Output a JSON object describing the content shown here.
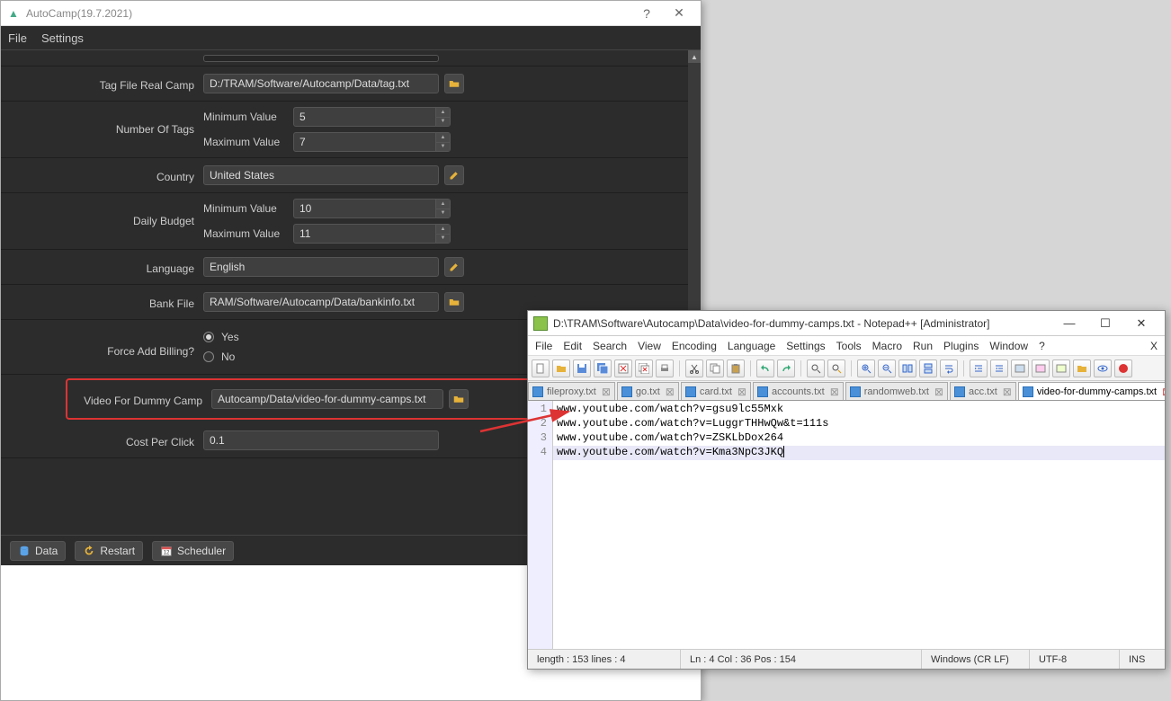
{
  "autocamp": {
    "title": "AutoCamp(19.7.2021)",
    "menus": {
      "file": "File",
      "settings": "Settings"
    },
    "rows": {
      "tagfile": {
        "label": "Tag File Real Camp",
        "value": "D:/TRAM/Software/Autocamp/Data/tag.txt"
      },
      "numtags": {
        "label": "Number Of Tags",
        "min_label": "Minimum Value",
        "min_val": "5",
        "max_label": "Maximum Value",
        "max_val": "7"
      },
      "country": {
        "label": "Country",
        "value": "United States"
      },
      "budget": {
        "label": "Daily Budget",
        "min_label": "Minimum Value",
        "min_val": "10",
        "max_label": "Maximum Value",
        "max_val": "11"
      },
      "language": {
        "label": "Language",
        "value": "English"
      },
      "bank": {
        "label": "Bank File",
        "value": "RAM/Software/Autocamp/Data/bankinfo.txt"
      },
      "force": {
        "label": "Force Add Billing?",
        "yes": "Yes",
        "no": "No"
      },
      "video": {
        "label": "Video For Dummy Camp",
        "value": "Autocamp/Data/video-for-dummy-camps.txt"
      },
      "cpc": {
        "label": "Cost Per Click",
        "value": "0.1"
      }
    },
    "bottom": {
      "data": "Data",
      "restart": "Restart",
      "scheduler": "Scheduler"
    }
  },
  "notepad": {
    "title": "D:\\TRAM\\Software\\Autocamp\\Data\\video-for-dummy-camps.txt - Notepad++ [Administrator]",
    "menus": [
      "File",
      "Edit",
      "Search",
      "View",
      "Encoding",
      "Language",
      "Settings",
      "Tools",
      "Macro",
      "Run",
      "Plugins",
      "Window",
      "?"
    ],
    "close_x": "X",
    "tabs": [
      {
        "name": "fileproxy.txt"
      },
      {
        "name": "go.txt"
      },
      {
        "name": "card.txt"
      },
      {
        "name": "accounts.txt"
      },
      {
        "name": "randomweb.txt"
      },
      {
        "name": "acc.txt"
      },
      {
        "name": "video-for-dummy-camps.txt",
        "active": true
      }
    ],
    "lines": [
      "www.youtube.com/watch?v=gsu9lc55Mxk",
      "www.youtube.com/watch?v=LuggrTHHwQw&t=111s",
      "www.youtube.com/watch?v=ZSKLbDox264",
      "www.youtube.com/watch?v=Kma3NpC3JKQ"
    ],
    "status": {
      "length": "length : 153    lines : 4",
      "pos": "Ln : 4    Col : 36    Pos : 154",
      "eol": "Windows (CR LF)",
      "enc": "UTF-8",
      "mode": "INS"
    }
  }
}
